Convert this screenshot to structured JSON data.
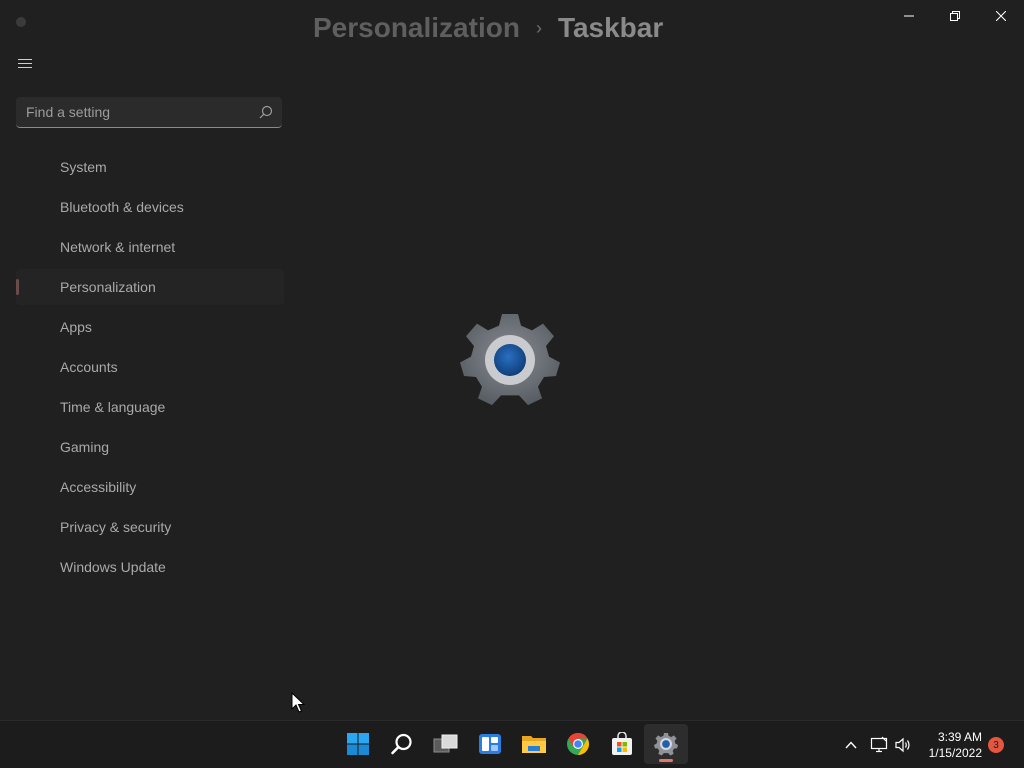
{
  "titlebar": {
    "minimize_glyph": "—",
    "maximize_glyph": "❐",
    "close_glyph": "✕"
  },
  "breadcrumb": {
    "parent": "Personalization",
    "separator": "›",
    "current": "Taskbar"
  },
  "search": {
    "placeholder": "Find a setting",
    "value": ""
  },
  "sidebar": {
    "items": [
      {
        "label": "System"
      },
      {
        "label": "Bluetooth & devices"
      },
      {
        "label": "Network & internet"
      },
      {
        "label": "Personalization",
        "selected": true
      },
      {
        "label": "Apps"
      },
      {
        "label": "Accounts"
      },
      {
        "label": "Time & language"
      },
      {
        "label": "Gaming"
      },
      {
        "label": "Accessibility"
      },
      {
        "label": "Privacy & security"
      },
      {
        "label": "Windows Update"
      }
    ]
  },
  "splash": {
    "icon": "settings-gear-icon"
  },
  "taskbar": {
    "apps": [
      {
        "name": "start-button",
        "icon": "windows-logo-icon"
      },
      {
        "name": "search-button",
        "icon": "search-icon"
      },
      {
        "name": "task-view-button",
        "icon": "task-view-icon"
      },
      {
        "name": "widgets-button",
        "icon": "widgets-icon"
      },
      {
        "name": "file-explorer-button",
        "icon": "folder-icon"
      },
      {
        "name": "chrome-button",
        "icon": "chrome-icon"
      },
      {
        "name": "store-button",
        "icon": "store-icon"
      },
      {
        "name": "settings-button",
        "icon": "settings-gear-icon",
        "active": true
      }
    ],
    "tray": {
      "time": "3:39 AM",
      "date": "1/15/2022",
      "notification_count": "3"
    }
  },
  "colors": {
    "background": "#202020",
    "taskbar": "#1c1c1c",
    "accent_indicator": "#e07a66",
    "badge": "#e4563d"
  }
}
